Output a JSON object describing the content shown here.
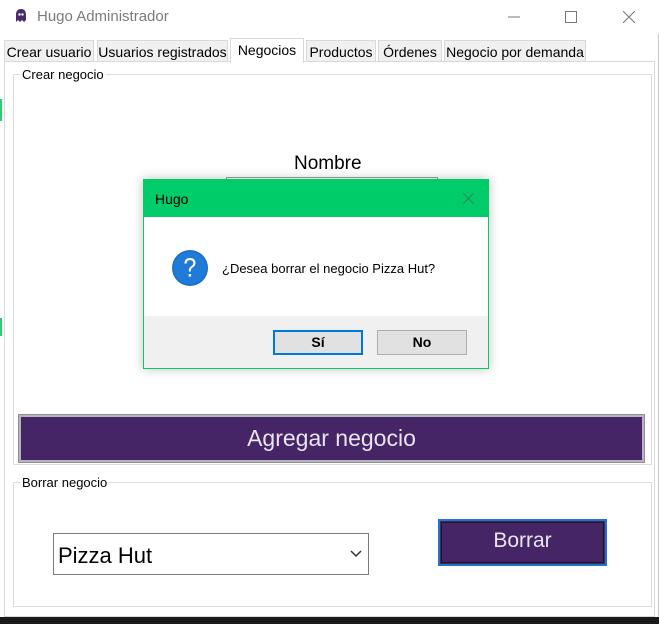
{
  "window": {
    "title": "Hugo Administrador",
    "app_icon": "ghost-icon"
  },
  "tabs": [
    {
      "label": "Crear usuario"
    },
    {
      "label": "Usuarios registrados"
    },
    {
      "label": "Negocios",
      "active": true
    },
    {
      "label": "Productos"
    },
    {
      "label": "Órdenes"
    },
    {
      "label": "Negocio por demanda"
    }
  ],
  "create_group": {
    "legend": "Crear negocio",
    "name_label": "Nombre",
    "name_value": "",
    "add_button": "Agregar negocio"
  },
  "delete_group": {
    "legend": "Borrar negocio",
    "selected_business": "Pizza Hut",
    "delete_button": "Borrar"
  },
  "dialog": {
    "title": "Hugo",
    "icon": "question-icon",
    "message": "¿Desea borrar el negocio Pizza Hut?",
    "yes_label": "Sí",
    "no_label": "No"
  },
  "colors": {
    "accent_purple": "#452565",
    "dialog_title_green": "#00cc6a",
    "focus_blue": "#0078d7"
  }
}
